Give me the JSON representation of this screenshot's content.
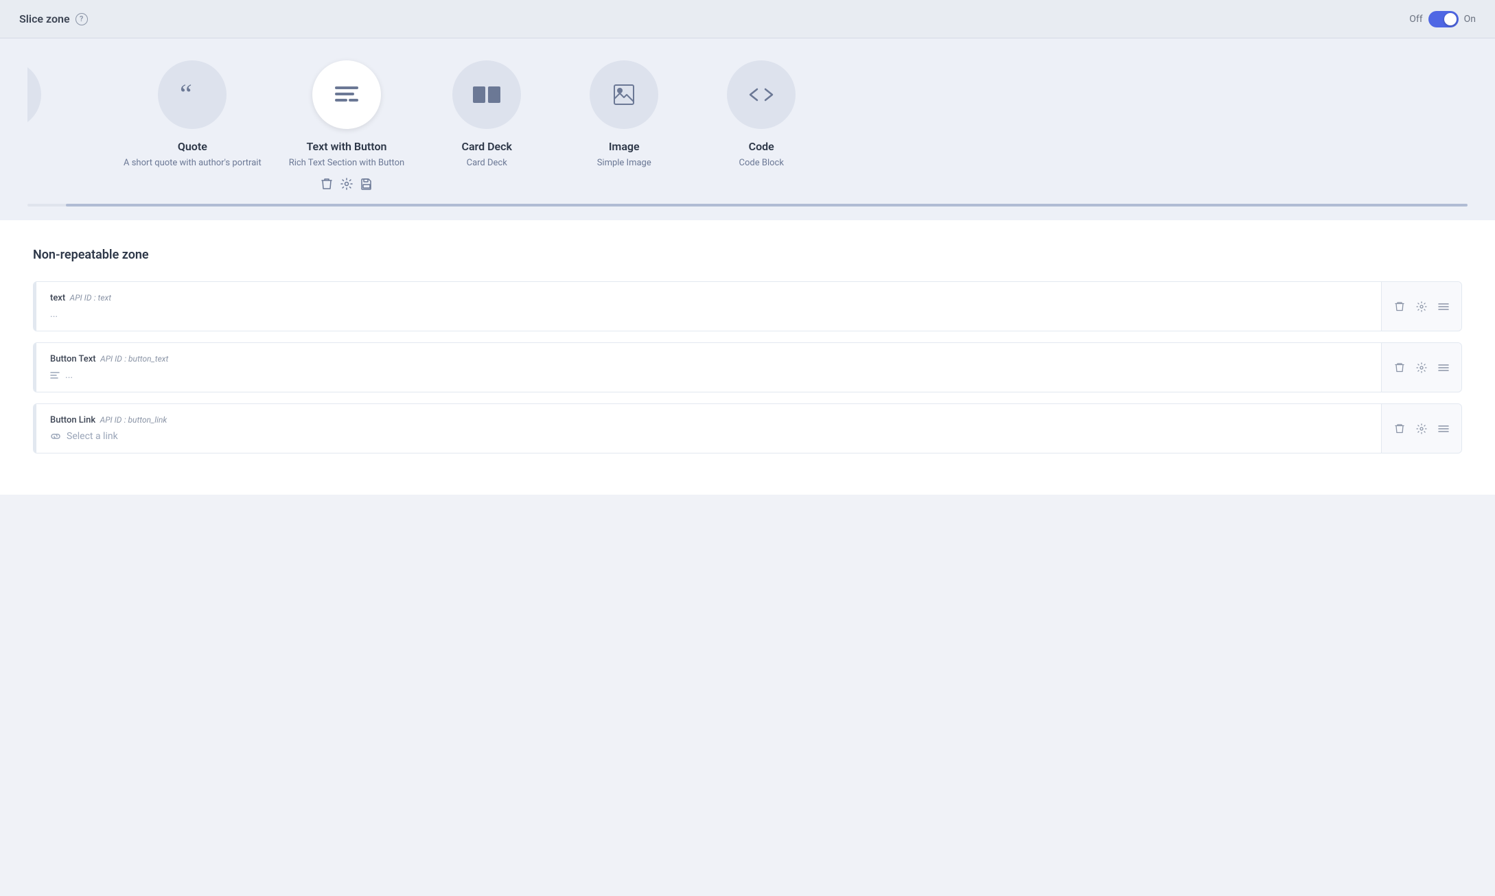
{
  "header": {
    "title": "Slice zone",
    "help_label": "?",
    "toggle_off_label": "Off",
    "toggle_on_label": "On",
    "toggle_state": "on"
  },
  "slices": {
    "items": [
      {
        "id": "quote",
        "name": "Quote",
        "description": "A short quote with author's portrait",
        "icon": "”",
        "active": false,
        "has_actions": false
      },
      {
        "id": "text-with-button",
        "name": "Text with Button",
        "description": "Rich Text Section with Button",
        "icon": "≡",
        "active": true,
        "has_actions": true
      },
      {
        "id": "card-deck",
        "name": "Card Deck",
        "description": "Card Deck",
        "icon": "▮",
        "active": false,
        "has_actions": false
      },
      {
        "id": "image",
        "name": "Image",
        "description": "Simple Image",
        "icon": "▣",
        "active": false,
        "has_actions": false
      },
      {
        "id": "code",
        "name": "Code",
        "description": "Code Block",
        "icon": "<>",
        "active": false,
        "has_actions": false
      }
    ],
    "partial_left": true,
    "actions": {
      "delete_label": "🗑",
      "settings_label": "⚙",
      "save_label": "💾"
    }
  },
  "non_repeatable_zone": {
    "title": "Non-repeatable zone",
    "fields": [
      {
        "id": "text-field",
        "label": "text",
        "api_id_label": "API ID",
        "api_id_separator": ":",
        "api_id_value": "text",
        "value": "..."
      },
      {
        "id": "button-text-field",
        "label": "Button Text",
        "api_id_label": "API ID",
        "api_id_separator": ":",
        "api_id_value": "button_text",
        "value": "..."
      },
      {
        "id": "button-link-field",
        "label": "Button Link",
        "api_id_label": "API ID",
        "api_id_separator": ":",
        "api_id_value": "button_link",
        "placeholder": "Select a link"
      }
    ],
    "action_labels": {
      "delete": "🗑",
      "settings": "⚙",
      "reorder": "☰"
    }
  }
}
